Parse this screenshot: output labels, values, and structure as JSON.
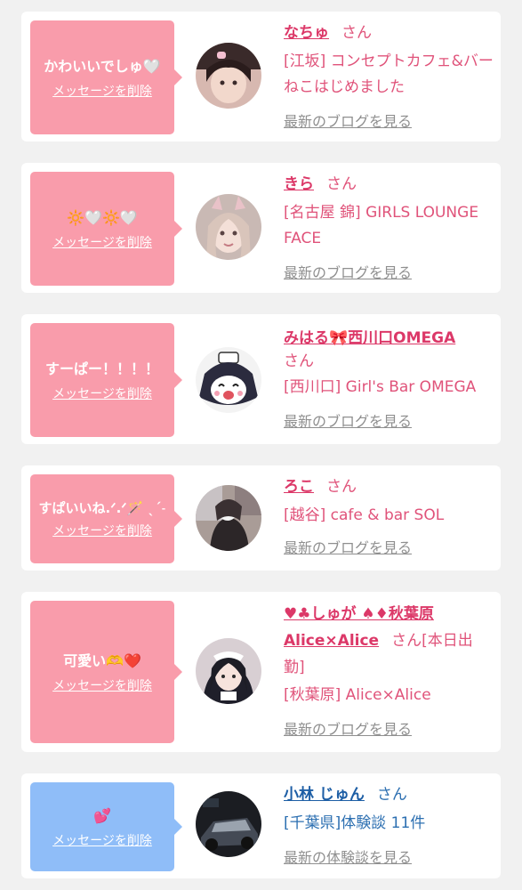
{
  "delete_label": "メッセージを削除",
  "honorific": "さん",
  "cards": [
    {
      "message": "かわいいでしゅ🤍",
      "name": "なちゅ",
      "store": "[江坂] コンセプトカフェ&バー　ねこはじめました",
      "link": "最新のブログを見る"
    },
    {
      "message": "🔆🤍🔆🤍",
      "name": "きら",
      "store": "[名古屋 錦] GIRLS LOUNGE FACE",
      "link": "最新のブログを見る"
    },
    {
      "message": "すーぱー！！！！",
      "name": "みはる🎀西川口OMEGA",
      "store": "[西川口] Girl's Bar OMEGA",
      "link": "最新のブログを見る"
    },
    {
      "message": "すぱいいね.ᐟ.ᐟ🪄 ˎˊ˗",
      "name": "ろこ",
      "store": "[越谷] cafe & bar SOL",
      "link": "最新のブログを見る"
    },
    {
      "message": "可愛い🫶❤️",
      "name": "♥♣しゅが ♠♦秋葉原Alice×Alice",
      "extra": "[本日出勤]",
      "store": "[秋葉原] Alice×Alice",
      "link": "最新のブログを見る"
    },
    {
      "message": "💕",
      "name": "小林 じゅん",
      "store": "[千葉県]体験談 11件",
      "link": "最新の体験談を見る"
    }
  ],
  "colors": {
    "page_bg": "#f1f1f1",
    "pink_bubble": "#f99cab",
    "blue_bubble": "#8fbdf8",
    "pink_text": "#e0537a",
    "blue_text": "#2c6fb1",
    "link_gray": "#8f8f8f"
  }
}
